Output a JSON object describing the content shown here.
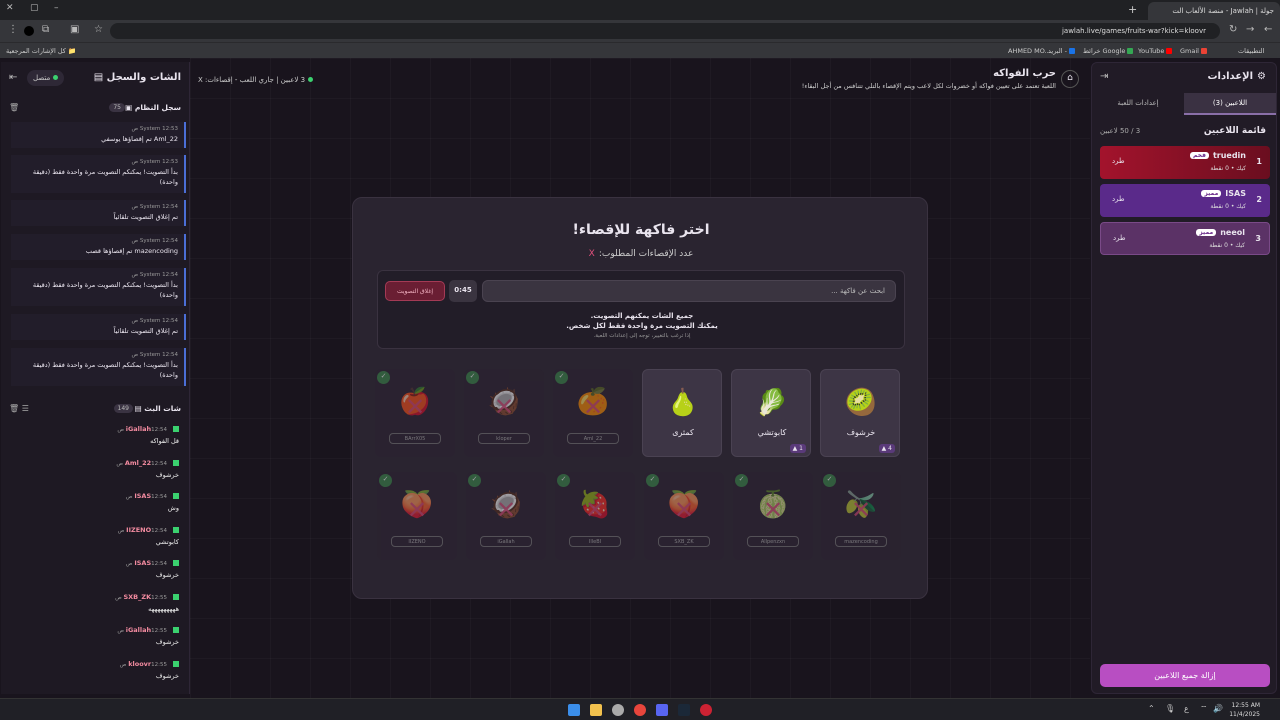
{
  "browser": {
    "tab_title": "جولة | Jawlah - منصة الألعاب الت",
    "url": "jawlah.live/games/fruits-war?kick=kloovr",
    "bookmarks": [
      "التطبيقات",
      "Gmail",
      "YouTube",
      "خرائط Google",
      "البريد -",
      "AHMED MO..."
    ],
    "all_bookmarks": "كل الإشارات المرجعية"
  },
  "header": {
    "title": "حرب الفواكه",
    "description": "اللعبة تعتمد على تعيين فواكه أو خضروات لكل لاعب ويتم الإقصاء بالتلي تتنافس من أجل البقاء!",
    "status": "3 لاعبين | جاري اللعب - إقصاءات: X"
  },
  "settings": {
    "title": "الإعدادات",
    "tab_players": "اللاعبين (3)",
    "tab_game": "إعدادات اللعبة",
    "list_title": "قائمة اللاعبين",
    "count": "3 / 50 لاعبين",
    "kick": "طرد",
    "clear_all": "إزالة جميع اللاعبين",
    "players": [
      {
        "num": "1",
        "name": "truedin",
        "badge": "فخم",
        "sub": "كيك • 0 نقطة",
        "color": "#a3132c"
      },
      {
        "num": "2",
        "name": "ISAS",
        "badge": "مميز",
        "sub": "كيك • 0 نقطة",
        "color": "#5a2a8a"
      },
      {
        "num": "3",
        "name": "neeol",
        "badge": "مميز",
        "sub": "كيك • 0 نقطة",
        "color": "#5b3266"
      }
    ]
  },
  "chat": {
    "title": "الشات والسجل",
    "status": "متصل",
    "system_title": "سجل النظام",
    "system_count": "75",
    "live_title": "شات البث",
    "live_count": "149"
  },
  "logs": [
    {
      "sender": "System",
      "time": "12:53 ص",
      "text": "Aml_22 تم إقصاؤها يوسفي"
    },
    {
      "sender": "System",
      "time": "12:53 ص",
      "text": "بدأ التصويت! يمكنكم التصويت مرة واحدة فقط (دقيقة واحدة)"
    },
    {
      "sender": "System",
      "time": "12:54 ص",
      "text": "تم إغلاق التصويت تلقائياً"
    },
    {
      "sender": "System",
      "time": "12:54 ص",
      "text": "mazencoding تم إقصاؤها قصب"
    },
    {
      "sender": "System",
      "time": "12:54 ص",
      "text": "بدأ التصويت! يمكنكم التصويت مرة واحدة فقط (دقيقة واحدة)"
    },
    {
      "sender": "System",
      "time": "12:54 ص",
      "text": "تم إغلاق التصويت تلقائياً"
    },
    {
      "sender": "System",
      "time": "12:54 ص",
      "text": "بدأ التصويت! يمكنكم التصويت مرة واحدة فقط (دقيقة واحدة)"
    }
  ],
  "messages": [
    {
      "user": "iGallah",
      "time": "12:54 ص",
      "text": "قل الفواكه"
    },
    {
      "user": "Aml_22",
      "time": "12:54 ص",
      "text": "خرشوف"
    },
    {
      "user": "ISAS",
      "time": "12:54 ص",
      "text": "وش"
    },
    {
      "user": "IIZENO",
      "time": "12:54 ص",
      "text": "كابوتشي"
    },
    {
      "user": "ISAS",
      "time": "12:54 ص",
      "text": "خرشوف"
    },
    {
      "user": "SXB_ZK",
      "time": "12:55 ص",
      "text": "هههههههههه"
    },
    {
      "user": "iGallah",
      "time": "12:55 ص",
      "text": "خرشوف"
    },
    {
      "user": "kloovr",
      "time": "12:55 ص",
      "text": "خرشوف"
    }
  ],
  "vote": {
    "title": "اختر فاكهة للإقصاء!",
    "required": "عدد الإقصاءات المطلوب:",
    "required_value": "X",
    "search_placeholder": "ابحث عن فاكهة ...",
    "timer": "0:45",
    "close_label": "إغلاق التصويت",
    "line1": "جميع الشات يمكنهم التصويت.",
    "line2": "يمكنك التصويت مرة واحدة فقط لكل شخص.",
    "line3": "إذا ترغب بالتغيير، توجه إلى إعدادات اللعبة."
  },
  "fruits_alive": [
    {
      "emoji": "🥝",
      "name": "خرشوف",
      "votes": "4"
    },
    {
      "emoji": "🥬",
      "name": "كابوتشي",
      "votes": "1"
    },
    {
      "emoji": "🍐",
      "name": "كمثرى",
      "votes": ""
    }
  ],
  "fruits_dead_row1": [
    {
      "emoji": "🍊",
      "player": "Aml_22"
    },
    {
      "emoji": "🥥",
      "player": "kloper"
    },
    {
      "emoji": "🍎",
      "player": "BArrX05"
    }
  ],
  "fruits_dead_row2": [
    {
      "emoji": "🫒",
      "player": "mazencoding"
    },
    {
      "emoji": "🍈",
      "player": "Allpenzxn"
    },
    {
      "emoji": "🍑",
      "player": "SXB_ZK"
    },
    {
      "emoji": "🍓",
      "player": "IlleBI"
    },
    {
      "emoji": "🥥",
      "player": "iGallah"
    },
    {
      "emoji": "🍑",
      "player": "IIZENO"
    }
  ],
  "clock": {
    "time": "12:55 AM",
    "date": "11/4/2025"
  }
}
